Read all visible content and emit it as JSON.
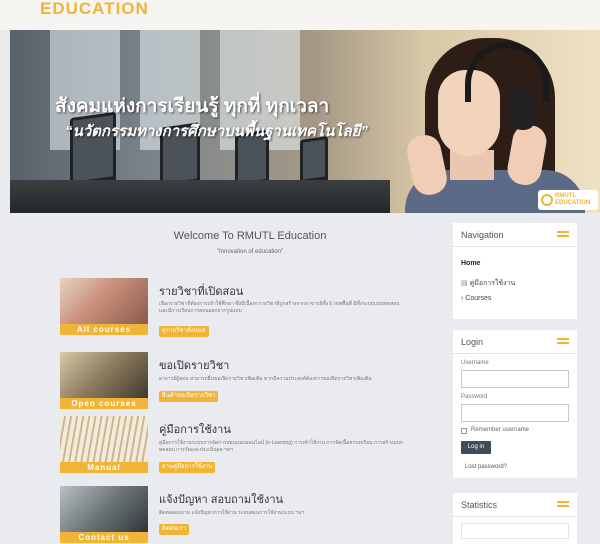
{
  "header": {
    "logo_text": "EDUCATION"
  },
  "banner": {
    "slogan_line1": "สังคมแห่งการเรียนรู้ ทุกที่ ทุกเวลา",
    "slogan_line2": "“นวัตกรรมทางการศึกษาบนพื้นฐานเทคโนโลยี”",
    "logo_top": "RMUTL",
    "logo_bottom": "EDUCATION"
  },
  "main": {
    "welcome": "Welcome To RMUTL Education",
    "motto": "\"Innovation of education\"",
    "cards": [
      {
        "image_label": "All courses",
        "title": "รายวิชาที่เปิดสอน",
        "description": "เลือกรายวิชาที่ต้องการเข้าใช้ศึกษา ซึ่งมีเนื้อหารายวิชาที่ถูกสร้างจากอาจารย์ทั้ง 6 เขตพื้นที่ มีทั้งระบบแบบทดสอบ และมีการเรียนการสอนออกจากรูปแบบ",
        "button": "ดูรายวิชาทั้งหมด"
      },
      {
        "image_label": "Open courses",
        "title": "ขอเปิดรายวิชา",
        "description": "อาจารย์ผู้สอน สามารถยื่นขอเปิดรายวิชาเพิ่มเติม หากมีความประสงค์ต้องการขอเปิดรายวิชาเพิ่มเติม",
        "button": "ยื่นคำขอเปิดรายวิชา"
      },
      {
        "image_label": "Manual",
        "title": "คู่มือการใช้งาน",
        "description": "คู่มือการใช้งานระบบการจัดการสอนแบบออนไลน์ (e-Learning) การเข้าใช้งาน การจัดเนื้อหาบทเรียน การสร้างแบบทดสอบ การวัดและประเมินผล ฯลฯ",
        "button": "อ่านคู่มือการใช้งาน"
      },
      {
        "image_label": "Contact us",
        "title": "แจ้งปัญหา สอบถามใช้งาน",
        "description": "ติดต่อสอบถาม แจ้งปัญหาการใช้งาน ระบบสอนการใช้งานระบบ ฯลฯ",
        "button": "ติดต่อเรา"
      }
    ]
  },
  "sidebar": {
    "navigation": {
      "title": "Navigation",
      "items": [
        {
          "label": "Home"
        },
        {
          "label": "คู่มือการใช้งาน"
        },
        {
          "label": "Courses"
        }
      ]
    },
    "login": {
      "title": "Login",
      "username_label": "Username",
      "username_value": "",
      "password_label": "Password",
      "password_value": "",
      "remember_label": "Remember username",
      "login_button": "Log in",
      "lost_password": "Lost password?"
    },
    "statistics": {
      "title": "Statistics"
    }
  },
  "colors": {
    "accent": "#f0b437",
    "login_button": "#3f4a5a",
    "page_bg": "#e9ebee"
  }
}
